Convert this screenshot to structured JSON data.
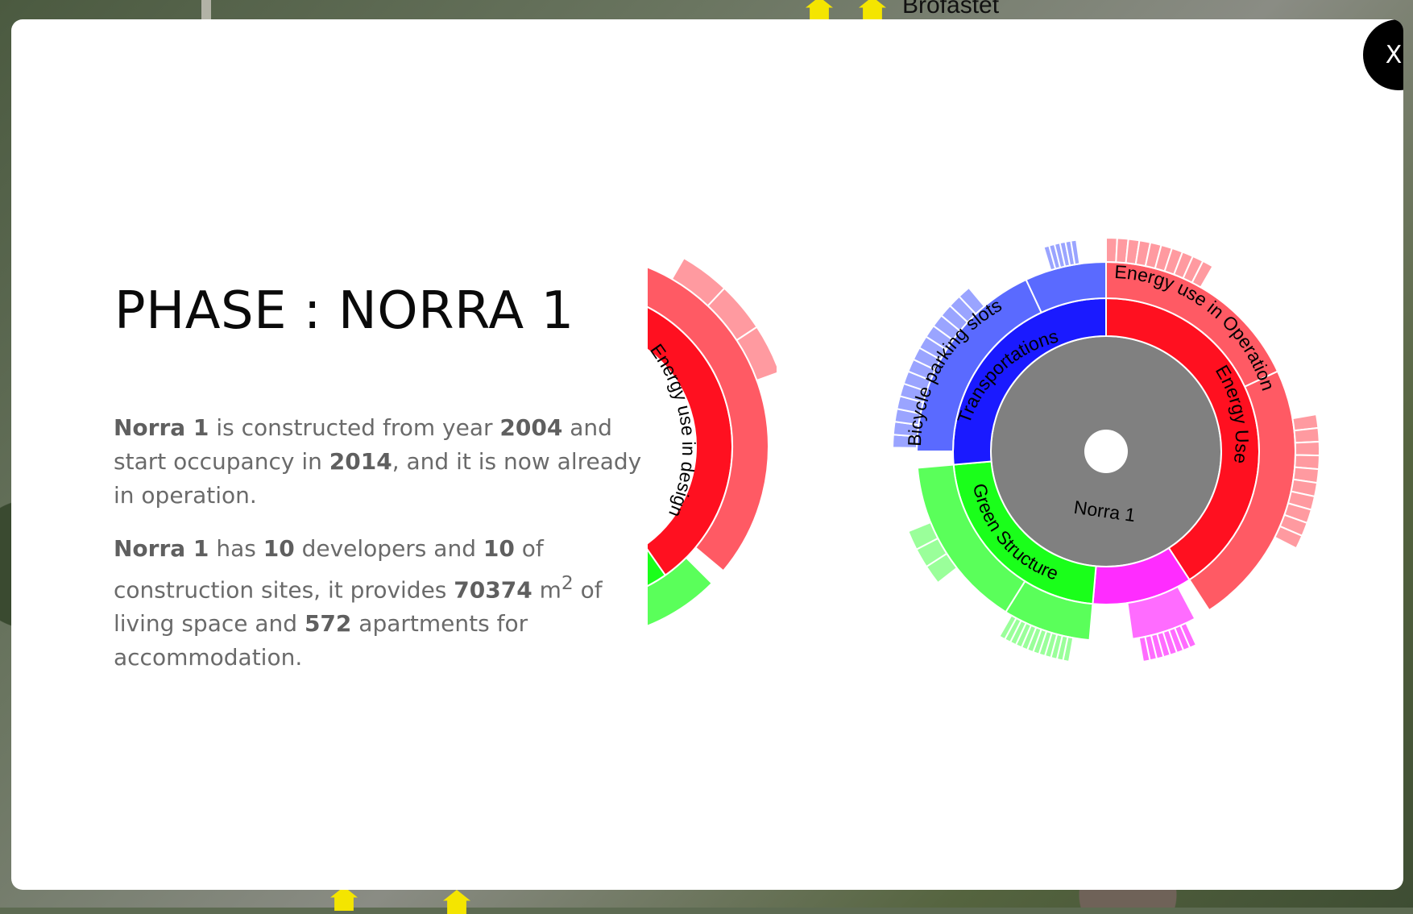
{
  "map": {
    "place_label": "Brofästet"
  },
  "modal": {
    "close_label": "X",
    "title": "PHASE : NORRA 1",
    "para1": {
      "name": "Norra 1",
      "t1": " is constructed from year ",
      "year_start": "2004",
      "t2": " and start occupancy in ",
      "year_occupancy": "2014",
      "t3": ", and it is now already in operation."
    },
    "para2": {
      "name": "Norra 1",
      "t1": " has ",
      "developers": "10",
      "t2": " developers and ",
      "sites": "10",
      "t3": " of construction sites, it provides ",
      "living_space": "70374",
      "unit": " m",
      "unit_sup": "2",
      "t4": " of living space and ",
      "apartments": "572",
      "t5": " apartments for accommodation."
    }
  },
  "chart_data": [
    {
      "type": "sunburst",
      "root": "Norra 1",
      "colors": {
        "root": "#808080",
        "energy": "#ff1020",
        "energy_light": "#ff5a64",
        "energy_lighter": "#ff9aa0",
        "transport": "#1a1aff",
        "transport_light": "#5a6aff",
        "transport_lighter": "#9aa4ff",
        "green": "#1aff1a",
        "green_light": "#5aff5a",
        "green_lighter": "#9aff9a",
        "pink": "#ff2cff",
        "pink_light": "#ff6cff"
      },
      "labels": {
        "energy_use": "Energy Use",
        "energy_operation": "Energy use in Operation",
        "transportations": "Transportations",
        "bicycle": "Bicycle parking slots",
        "green_structure": "Green Structure"
      }
    },
    {
      "type": "sunburst",
      "labels": {
        "energy_design": "Energy use in design"
      }
    }
  ]
}
